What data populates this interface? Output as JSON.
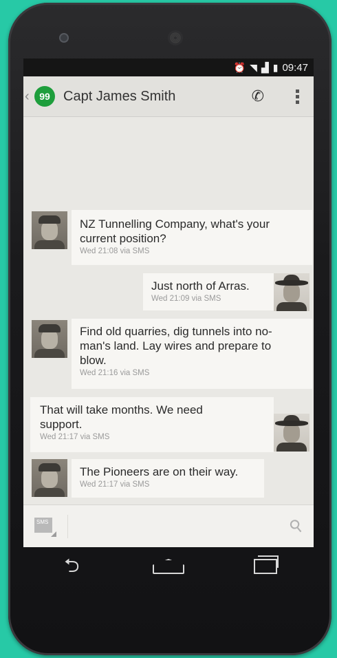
{
  "status_bar": {
    "time": "09:47",
    "icons": [
      "alarm-icon",
      "wifi-icon",
      "signal-icon",
      "battery-icon"
    ]
  },
  "app_bar": {
    "title": "Capt James Smith",
    "app_icon_glyph": "99",
    "accent": "#1e9e3c"
  },
  "messages": [
    {
      "from": "them",
      "text_lines": [
        "NZ Tunnelling Company, what's your",
        "current position?"
      ],
      "meta": "Wed 21:08 via SMS"
    },
    {
      "from": "me",
      "text_lines": [
        "Just north of Arras."
      ],
      "meta": "Wed 21:09 via SMS"
    },
    {
      "from": "them",
      "text_lines": [
        "Find old quarries, dig tunnels into no-",
        "man's land. Lay wires and prepare to",
        "blow."
      ],
      "meta": "Wed 21:16 via SMS"
    },
    {
      "from": "me",
      "text_lines": [
        "That will take months. We need",
        "support."
      ],
      "meta": "Wed 21:17 via SMS"
    },
    {
      "from": "them",
      "text_lines": [
        "The Pioneers are on their way."
      ],
      "meta": "Wed 21:17 via SMS"
    }
  ],
  "composer": {
    "sms_badge": "SMS",
    "placeholder": ""
  },
  "nav": [
    "back-icon",
    "home-icon",
    "recents-icon"
  ]
}
